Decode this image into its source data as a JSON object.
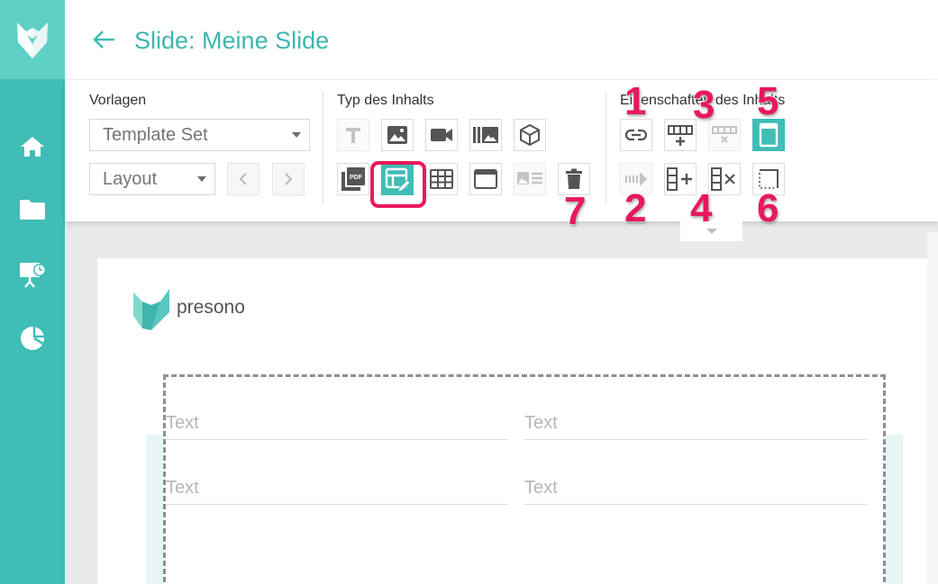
{
  "header": {
    "title": "Slide: Meine Slide"
  },
  "sidebar": {
    "items": [
      {
        "name": "home-icon"
      },
      {
        "name": "folder-icon"
      },
      {
        "name": "presentation-icon"
      },
      {
        "name": "pie-chart-icon"
      }
    ]
  },
  "toolbar": {
    "vorlagen": {
      "label": "Vorlagen",
      "template_set": "Template Set",
      "layout": "Layout"
    },
    "typ": {
      "label": "Typ des Inhalts"
    },
    "eigenschaften": {
      "label": "Eigenschaften des Inhalts"
    }
  },
  "callouts": [
    "1",
    "2",
    "3",
    "4",
    "5",
    "6",
    "7"
  ],
  "slide": {
    "brand": "presono",
    "fields": [
      {
        "placeholder": "Text"
      },
      {
        "placeholder": "Text"
      },
      {
        "placeholder": "Text"
      },
      {
        "placeholder": "Text"
      }
    ]
  },
  "colors": {
    "accent": "#3fbdb6",
    "highlight": "#e8195a",
    "title": "#3fb5ad"
  }
}
